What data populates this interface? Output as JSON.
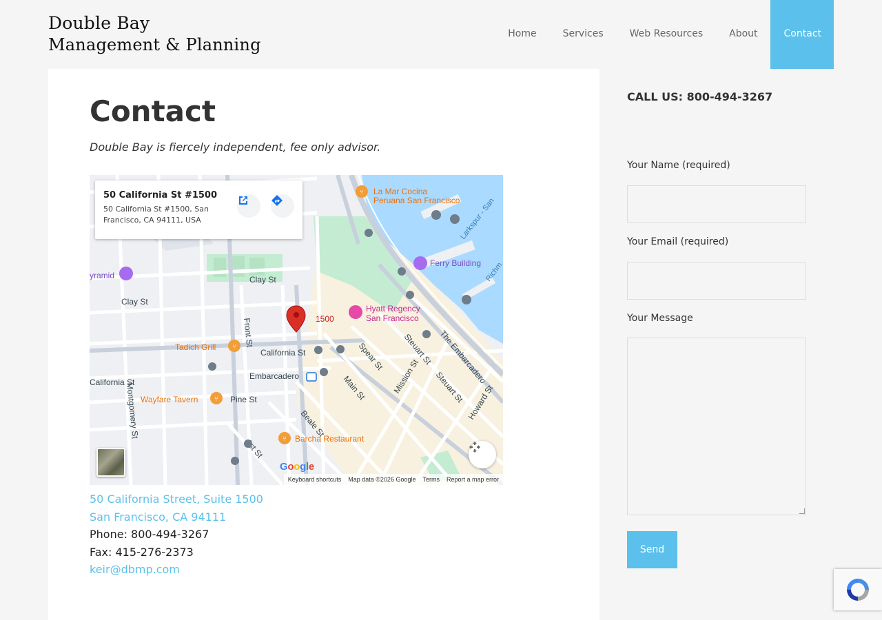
{
  "site": {
    "logo_line1": "Double Bay",
    "logo_line2": "Management & Planning"
  },
  "nav": {
    "items": [
      {
        "label": "Home"
      },
      {
        "label": "Services"
      },
      {
        "label": "Web Resources"
      },
      {
        "label": "About"
      },
      {
        "label": "Contact",
        "active": true
      }
    ]
  },
  "page": {
    "title": "Contact",
    "tagline": "Double Bay is fiercely independent, fee only advisor."
  },
  "map": {
    "card_title": "50 California St #1500",
    "card_address": "50 California St #1500, San Francisco, CA 94111, USA",
    "pin_label": "1500",
    "labels": {
      "la_mar": "La Mar Cocina",
      "la_mar2": "Peruana San Francisco",
      "ferry": "Ferry Building",
      "hyatt": "Hyatt Regency",
      "hyatt2": "San Francisco",
      "tadich": "Tadich Grill",
      "wayfare": "Wayfare Tavern",
      "barcha": "Barcha Restaurant",
      "embarcadero": "Embarcadero",
      "pyramid": "yramid",
      "clay1": "Clay St",
      "clay2": "Clay St",
      "california1": "California St",
      "california2": "California St",
      "pine": "Pine St",
      "front": "Front St",
      "montgomery": "Montgomery St",
      "spear": "Spear St",
      "main": "Main St",
      "beale": "Beale St",
      "first": "1st St",
      "mission": "Mission St",
      "steuart1": "Steuart St",
      "steuart2": "Steuart St",
      "embarcadero_st": "The Embarcadero",
      "howard": "Howard St",
      "larkspur": "Larkspur - San",
      "richmond": "Richm"
    },
    "attribution": {
      "shortcuts": "Keyboard shortcuts",
      "data": "Map data ©2026 Google",
      "terms": "Terms",
      "report": "Report a map error"
    },
    "google_letters": [
      "G",
      "o",
      "o",
      "g",
      "l",
      "e"
    ],
    "colors": {
      "water": "#aadaff",
      "park": "#c3ecd2",
      "land": "#f8f1e0",
      "road": "#ffffff",
      "accent": "#5bc0eb",
      "pin": "#d93025",
      "food": "#f29e38",
      "transit": "#6f7c8a",
      "hotel": "#e649a6",
      "landmark": "#a66cf0"
    }
  },
  "contact": {
    "address_line1": "50 California Street, Suite 1500",
    "address_line2": "San Francisco, CA 94111",
    "phone": "Phone: 800-494-3267",
    "fax": "Fax: 415-276-2373",
    "email": "keir@dbmp.com"
  },
  "sidebar": {
    "call_us": "CALL US: 800-494-3267",
    "form": {
      "name_label": "Your Name (required)",
      "email_label": "Your Email (required)",
      "message_label": "Your Message",
      "name_value": "",
      "email_value": "",
      "message_value": "",
      "send_label": "Send"
    }
  },
  "icons": {
    "open_external": "open-in-new-icon",
    "directions": "directions-icon",
    "fullscreen": "fullscreen-icon",
    "recaptcha": "recaptcha-icon"
  }
}
